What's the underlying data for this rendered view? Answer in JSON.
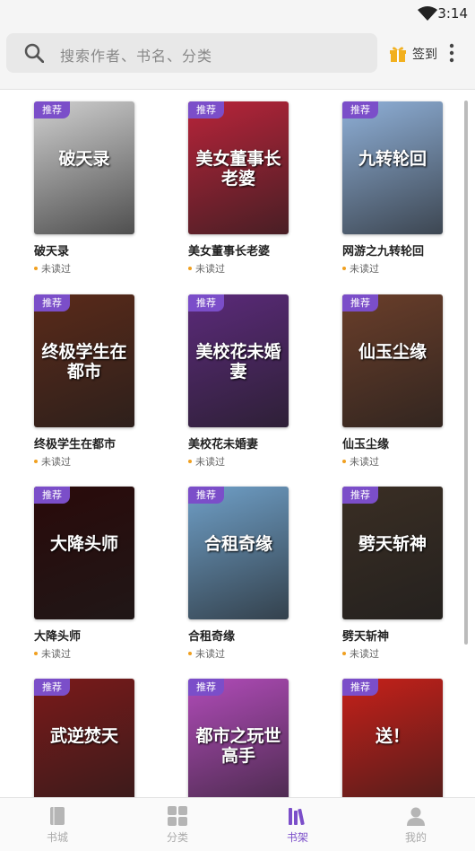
{
  "status_bar": {
    "time": "3:14"
  },
  "search": {
    "placeholder": "搜索作者、书名、分类"
  },
  "header": {
    "signin_label": "签到"
  },
  "badge_label": "推荐",
  "books": [
    {
      "title": "破天录",
      "status": "未读过",
      "cover_text": "破天录",
      "cover_color": "#cfcfcf"
    },
    {
      "title": "美女董事长老婆",
      "status": "未读过",
      "cover_text": "美女董事长老婆",
      "cover_color": "#b8243a"
    },
    {
      "title": "网游之九转轮回",
      "status": "未读过",
      "cover_text": "九转轮回",
      "cover_color": "#8fb0d8"
    },
    {
      "title": "终极学生在都市",
      "status": "未读过",
      "cover_text": "终极学生在都市",
      "cover_color": "#5a2a1a"
    },
    {
      "title": "美校花未婚妻",
      "status": "未读过",
      "cover_text": "美校花未婚妻",
      "cover_color": "#5b2a7a"
    },
    {
      "title": "仙玉尘缘",
      "status": "未读过",
      "cover_text": "仙玉尘缘",
      "cover_color": "#6a3e2a"
    },
    {
      "title": "大降头师",
      "status": "未读过",
      "cover_text": "大降头师",
      "cover_color": "#2a0a0a"
    },
    {
      "title": "合租奇缘",
      "status": "未读过",
      "cover_text": "合租奇缘",
      "cover_color": "#6f9fc7"
    },
    {
      "title": "劈天斩神",
      "status": "未读过",
      "cover_text": "劈天斩神",
      "cover_color": "#3a2e24"
    },
    {
      "title": "",
      "status": "",
      "cover_text": "武逆焚天",
      "cover_color": "#7a1a1a"
    },
    {
      "title": "",
      "status": "",
      "cover_text": "都市之玩世高手",
      "cover_color": "#b04bb8"
    },
    {
      "title": "",
      "status": "",
      "cover_text": "送！",
      "cover_color": "#c6201a"
    }
  ],
  "bottom_nav": [
    {
      "label": "书城",
      "icon": "book-icon"
    },
    {
      "label": "分类",
      "icon": "grid-icon"
    },
    {
      "label": "书架",
      "icon": "shelf-icon",
      "active": true
    },
    {
      "label": "我的",
      "icon": "user-icon"
    }
  ],
  "colors": {
    "accent": "#7b4ec9",
    "unread_dot": "#f0a020"
  }
}
